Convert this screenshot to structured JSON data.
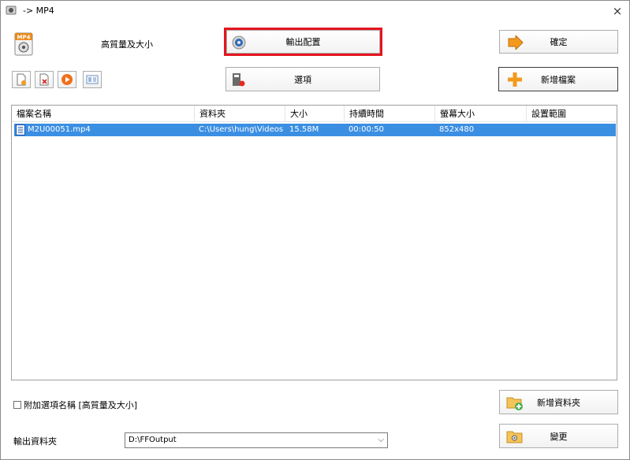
{
  "window": {
    "title": "-> MP4",
    "close_glyph": "×"
  },
  "profile": {
    "label": "高質量及大小",
    "icon": "mp4-format-icon"
  },
  "buttons": {
    "output_config": "輸出配置",
    "options": "選項",
    "ok": "確定",
    "add_file": "新增檔案",
    "add_folder": "新增資料夾",
    "change": "變更"
  },
  "toolbar_icons": [
    "add-file-icon",
    "remove-file-icon",
    "play-icon",
    "media-info-icon"
  ],
  "file_list": {
    "columns": [
      "檔案名稱",
      "資料夾",
      "大小",
      "持續時間",
      "螢幕大小",
      "設置範圍"
    ],
    "rows": [
      {
        "name": "M2U00051.mp4",
        "folder": "C:\\Users\\hung\\Videos",
        "size": "15.58M",
        "duration": "00:00:50",
        "screen": "852x480",
        "range": ""
      }
    ]
  },
  "append_option": {
    "label": "附加選項名稱 [高質量及大小]",
    "checked": false
  },
  "output_folder": {
    "label": "輸出資料夾",
    "value": "D:\\FFOutput"
  },
  "colors": {
    "selection": "#3b8fe3",
    "highlight_border": "#e4151f",
    "accent_orange": "#f39a1e"
  }
}
